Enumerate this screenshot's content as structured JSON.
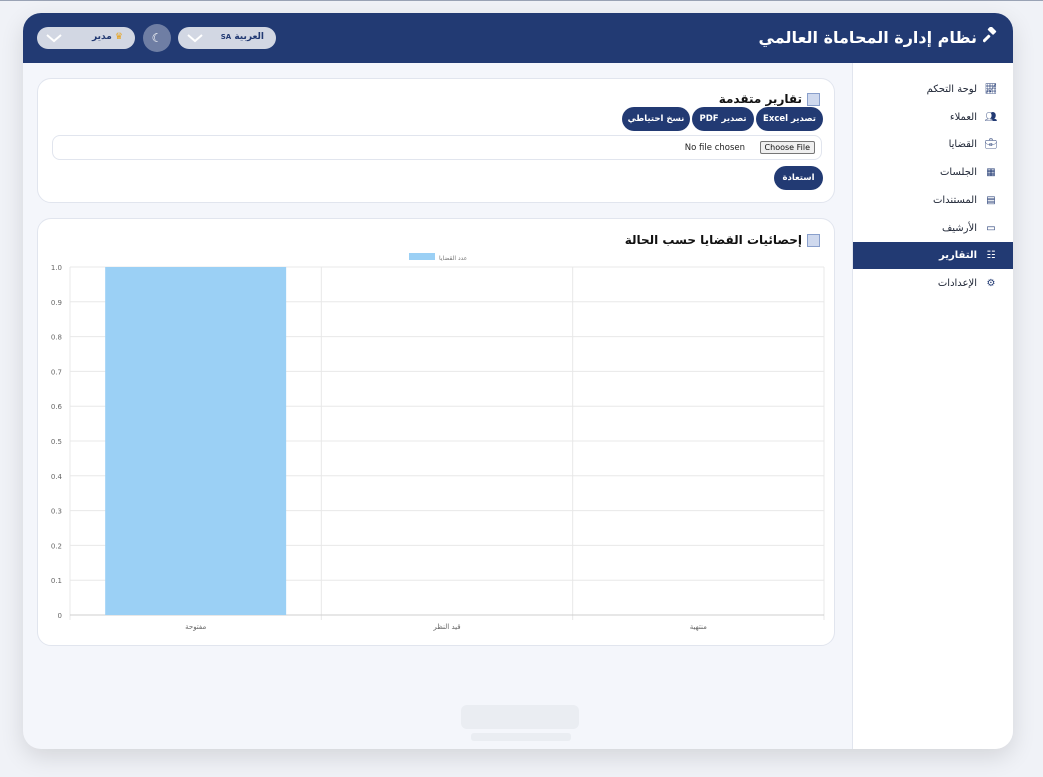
{
  "header": {
    "title": "نظام إدارة المحاماة العالمي",
    "language_label": "العربية",
    "language_code": "SA",
    "user_label": "مدير",
    "theme_icon": "moon-icon",
    "colors": {
      "primary": "#223a73",
      "bar": "#9bd0f5"
    }
  },
  "sidebar": {
    "items": [
      {
        "label": "لوحة التحكم",
        "icon": "chart-line-icon"
      },
      {
        "label": "العملاء",
        "icon": "users-icon"
      },
      {
        "label": "القضايا",
        "icon": "briefcase-icon"
      },
      {
        "label": "الجلسات",
        "icon": "calendar-icon"
      },
      {
        "label": "المستندات",
        "icon": "file-icon"
      },
      {
        "label": "الأرشيف",
        "icon": "archive-icon"
      },
      {
        "label": "التقارير",
        "icon": "report-icon",
        "active": true
      },
      {
        "label": "الإعدادات",
        "icon": "gear-icon"
      }
    ]
  },
  "reports": {
    "title": "تقارير متقدمة",
    "buttons": {
      "export_excel": "تصدير Excel",
      "export_pdf": "تصدير PDF",
      "backup": "نسخ احتياطي",
      "restore": "استعادة"
    },
    "file_input": {
      "button": "Choose File",
      "status": "No file chosen"
    }
  },
  "stats": {
    "title": "إحصائيات القضايا حسب الحالة"
  },
  "chart_data": {
    "type": "bar",
    "categories": [
      "مفتوحة",
      "قيد النظر",
      "منتهية"
    ],
    "series": [
      {
        "name": "عدد القضايا",
        "values": [
          1,
          0,
          0
        ]
      }
    ],
    "yticks": [
      "0",
      "0.1",
      "0.2",
      "0.3",
      "0.4",
      "0.5",
      "0.6",
      "0.7",
      "0.8",
      "0.9",
      "1.0"
    ],
    "ylim": [
      0,
      1
    ],
    "grid": true,
    "legend": "top-center"
  }
}
